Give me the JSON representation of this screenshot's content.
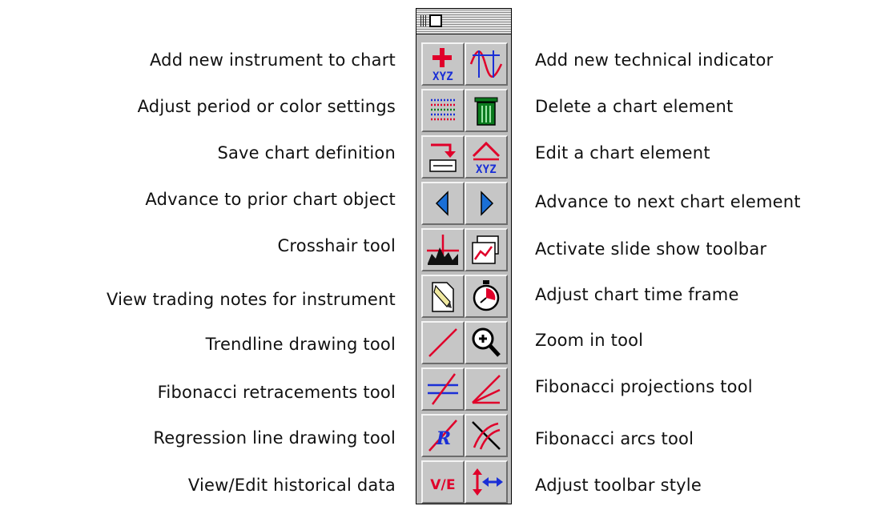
{
  "toolbar": {
    "rows": [
      {
        "left_label": "Add new instrument to chart",
        "right_label": "Add new technical indicator",
        "left_icon": "add-instrument-icon",
        "right_icon": "add-indicator-icon",
        "left_icon_text": "XYZ",
        "right_icon_text": ""
      },
      {
        "left_label": "Adjust period or color settings",
        "right_label": "Delete a chart element",
        "left_icon": "settings-list-icon",
        "right_icon": "trash-can-icon",
        "left_icon_text": "",
        "right_icon_text": ""
      },
      {
        "left_label": "Save chart definition",
        "right_label": "Edit a chart element",
        "left_icon": "save-chart-icon",
        "right_icon": "edit-element-icon",
        "left_icon_text": "",
        "right_icon_text": "XYZ"
      },
      {
        "left_label": "Advance to prior chart object",
        "right_label": "Advance to next chart element",
        "left_icon": "arrow-left-icon",
        "right_icon": "arrow-right-icon",
        "left_icon_text": "",
        "right_icon_text": ""
      },
      {
        "left_label": "Crosshair tool",
        "right_label": "Activate slide show toolbar",
        "left_icon": "crosshair-chart-icon",
        "right_icon": "slide-show-icon",
        "left_icon_text": "",
        "right_icon_text": ""
      },
      {
        "left_label": "View trading notes for instrument",
        "right_label": "Adjust chart time frame",
        "left_icon": "notes-icon",
        "right_icon": "stopwatch-icon",
        "left_icon_text": "",
        "right_icon_text": ""
      },
      {
        "left_label": "Trendline drawing tool",
        "right_label": "Zoom in tool",
        "left_icon": "trendline-icon",
        "right_icon": "zoom-in-icon",
        "left_icon_text": "",
        "right_icon_text": ""
      },
      {
        "left_label": "Fibonacci retracements tool",
        "right_label": "Fibonacci projections tool",
        "left_icon": "fib-retracement-icon",
        "right_icon": "fib-projection-icon",
        "left_icon_text": "",
        "right_icon_text": ""
      },
      {
        "left_label": "Regression line drawing tool",
        "right_label": "Fibonacci arcs tool",
        "left_icon": "regression-line-icon",
        "right_icon": "fib-arcs-icon",
        "left_icon_text": "R",
        "right_icon_text": ""
      },
      {
        "left_label": "View/Edit historical data",
        "right_label": "Adjust toolbar style",
        "left_icon": "historical-data-icon",
        "right_icon": "toolbar-style-icon",
        "left_icon_text": "V/E",
        "right_icon_text": ""
      }
    ]
  },
  "colors": {
    "toolbar_face": "#c6c6c6",
    "icon_red": "#e0002a",
    "icon_blue": "#1a2fd6",
    "icon_green": "#0b7a1e"
  }
}
